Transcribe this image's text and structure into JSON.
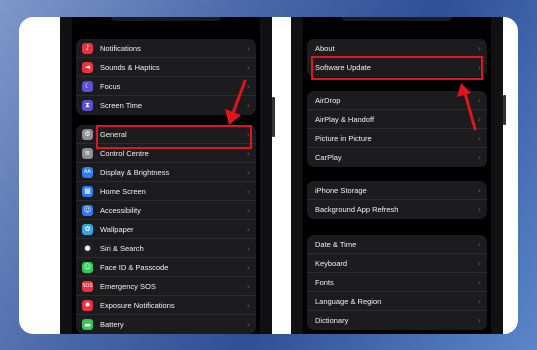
{
  "left_phone": {
    "group1": [
      {
        "label": "Notifications",
        "icon": "bell-icon",
        "color": "#e8323f",
        "glyph": "♪"
      },
      {
        "label": "Sounds & Haptics",
        "icon": "speaker-icon",
        "color": "#e8323f",
        "glyph": "◄"
      },
      {
        "label": "Focus",
        "icon": "moon-icon",
        "color": "#5b4fd6",
        "glyph": "☾"
      },
      {
        "label": "Screen Time",
        "icon": "hourglass-icon",
        "color": "#5b4fd6",
        "glyph": "⧗"
      }
    ],
    "group2": [
      {
        "label": "General",
        "icon": "gear-icon",
        "color": "#8e8e93",
        "glyph": "⚙"
      },
      {
        "label": "Control Centre",
        "icon": "switches-icon",
        "color": "#8e8e93",
        "glyph": "≡"
      },
      {
        "label": "Display & Brightness",
        "icon": "display-icon",
        "color": "#2f7bf5",
        "glyph": "AA"
      },
      {
        "label": "Home Screen",
        "icon": "grid-icon",
        "color": "#2f7bf5",
        "glyph": "▦"
      },
      {
        "label": "Accessibility",
        "icon": "accessibility-icon",
        "color": "#2f7bf5",
        "glyph": "☺"
      },
      {
        "label": "Wallpaper",
        "icon": "flower-icon",
        "color": "#35a4e8",
        "glyph": "✿"
      },
      {
        "label": "Siri & Search",
        "icon": "siri-icon",
        "color": "#222226",
        "glyph": "●"
      },
      {
        "label": "Face ID & Passcode",
        "icon": "face-id-icon",
        "color": "#34c759",
        "glyph": "☺"
      },
      {
        "label": "Emergency SOS",
        "icon": "sos-icon",
        "color": "#e8323f",
        "glyph": "SOS"
      },
      {
        "label": "Exposure Notifications",
        "icon": "exposure-icon",
        "color": "#e8323f",
        "glyph": "✹"
      },
      {
        "label": "Battery",
        "icon": "battery-icon",
        "color": "#34c759",
        "glyph": "▬"
      }
    ]
  },
  "right_phone": {
    "group1": [
      {
        "label": "About"
      },
      {
        "label": "Software Update"
      }
    ],
    "group2": [
      {
        "label": "AirDrop"
      },
      {
        "label": "AirPlay & Handoff"
      },
      {
        "label": "Picture in Picture"
      },
      {
        "label": "CarPlay"
      }
    ],
    "group3": [
      {
        "label": "iPhone Storage"
      },
      {
        "label": "Background App Refresh"
      }
    ],
    "group4": [
      {
        "label": "Date & Time"
      },
      {
        "label": "Keyboard"
      },
      {
        "label": "Fonts"
      },
      {
        "label": "Language & Region"
      },
      {
        "label": "Dictionary"
      }
    ]
  },
  "chevron": "›",
  "highlight_color": "#e0141c"
}
